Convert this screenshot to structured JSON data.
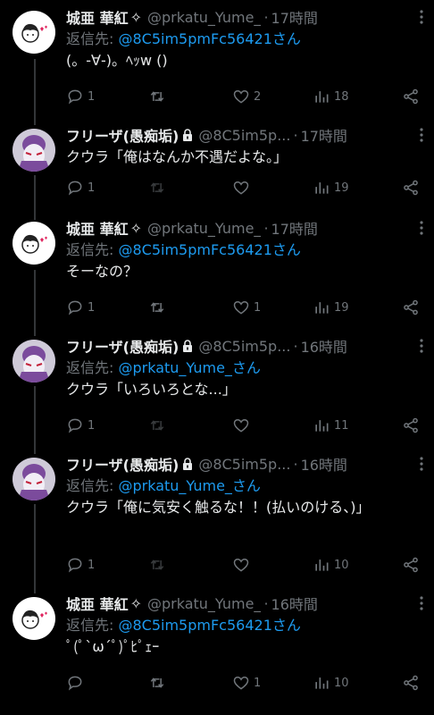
{
  "accent": "#1d9bf0",
  "tweets": [
    {
      "name": "城亜 華紅",
      "badge": "✧",
      "handle": "@prkatu_Yume_",
      "time": "17時間",
      "reply_prefix": "返信先: ",
      "reply_to": "@8C5im5pmFc56421さん",
      "text": "(。-∀-)。ﾍｯw ()",
      "replies": "1",
      "retweets": "",
      "likes": "2",
      "views": "18",
      "avatar": "white"
    },
    {
      "name": "フリーザ(愚痴垢)",
      "handle": "@8C5im5p...",
      "time": "17時間",
      "text": "クウラ「俺はなんか不遇だよな。」",
      "replies": "1",
      "retweets": "",
      "likes": "",
      "views": "19",
      "avatar": "frieza",
      "locked": true
    },
    {
      "name": "城亜 華紅",
      "badge": "✧",
      "handle": "@prkatu_Yume_",
      "time": "17時間",
      "reply_prefix": "返信先: ",
      "reply_to": "@8C5im5pmFc56421さん",
      "text": "そーなの？",
      "replies": "1",
      "retweets": "",
      "likes": "1",
      "views": "19",
      "avatar": "white"
    },
    {
      "name": "フリーザ(愚痴垢)",
      "handle": "@8C5im5p...",
      "time": "16時間",
      "reply_prefix": "返信先: ",
      "reply_to": "@prkatu_Yume_さん",
      "text": "クウラ「いろいろとな...」",
      "replies": "1",
      "retweets": "",
      "likes": "",
      "views": "11",
      "avatar": "frieza",
      "locked": true
    },
    {
      "name": "フリーザ(愚痴垢)",
      "handle": "@8C5im5p...",
      "time": "16時間",
      "reply_prefix": "返信先: ",
      "reply_to": "@prkatu_Yume_さん",
      "text": "クウラ「俺に気安く触るな！！(払いのける、)」",
      "replies": "1",
      "retweets": "",
      "likes": "",
      "views": "10",
      "avatar": "frieza",
      "locked": true
    },
    {
      "name": "城亜 華紅",
      "badge": "✧",
      "handle": "@prkatu_Yume_",
      "time": "16時間",
      "reply_prefix": "返信先: ",
      "reply_to": "@8C5im5pmFc56421さん",
      "text": "ﾟ(ﾟ`ω´ﾟ)ﾟﾋﾟｪｰ",
      "replies": "",
      "retweets": "",
      "likes": "1",
      "views": "10",
      "avatar": "white"
    }
  ]
}
